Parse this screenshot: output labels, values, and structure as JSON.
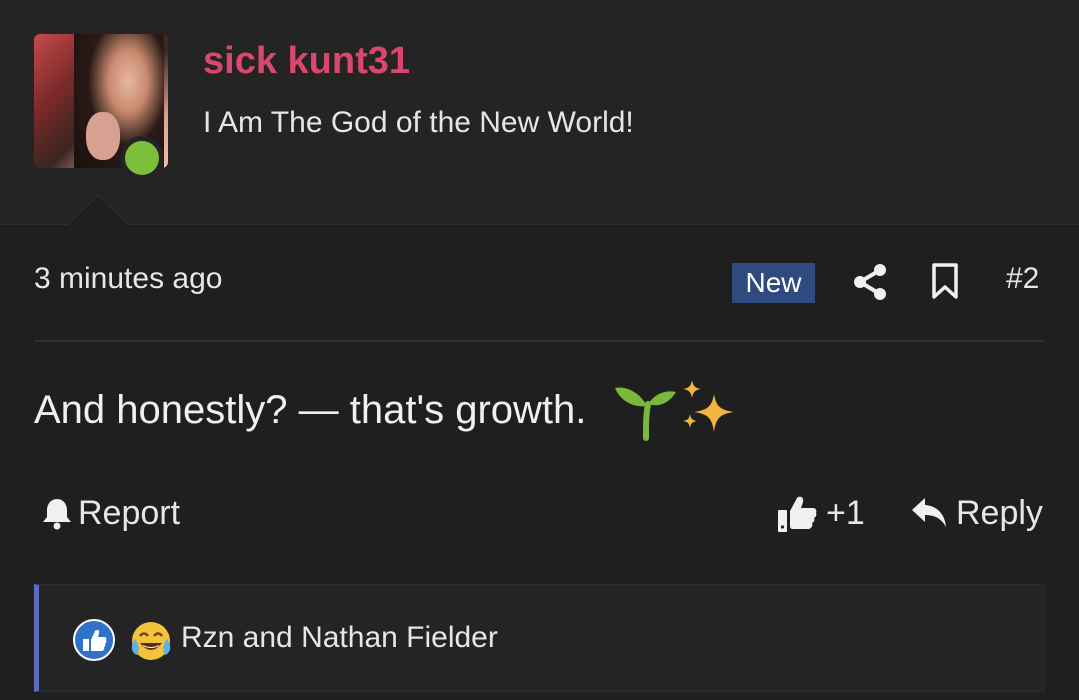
{
  "user": {
    "name": "sick kunt31",
    "title": "I Am The God of the New World!",
    "status": "online",
    "name_color": "#d9476f",
    "status_color": "#7cbf3a"
  },
  "post": {
    "timestamp": "3 minutes ago",
    "badge": "New",
    "badge_color": "#2f4a7f",
    "number": "#2",
    "text": "And honestly? — that's growth.",
    "emojis": [
      "seedling-icon",
      "sparkles-icon"
    ]
  },
  "actions": {
    "report_label": "Report",
    "like_count": "+1",
    "reply_label": "Reply"
  },
  "reactions": {
    "icons": [
      "like-icon",
      "laughing-crying-icon"
    ],
    "text": "Rzn and Nathan Fielder",
    "accent_color": "#5b6bbf"
  }
}
